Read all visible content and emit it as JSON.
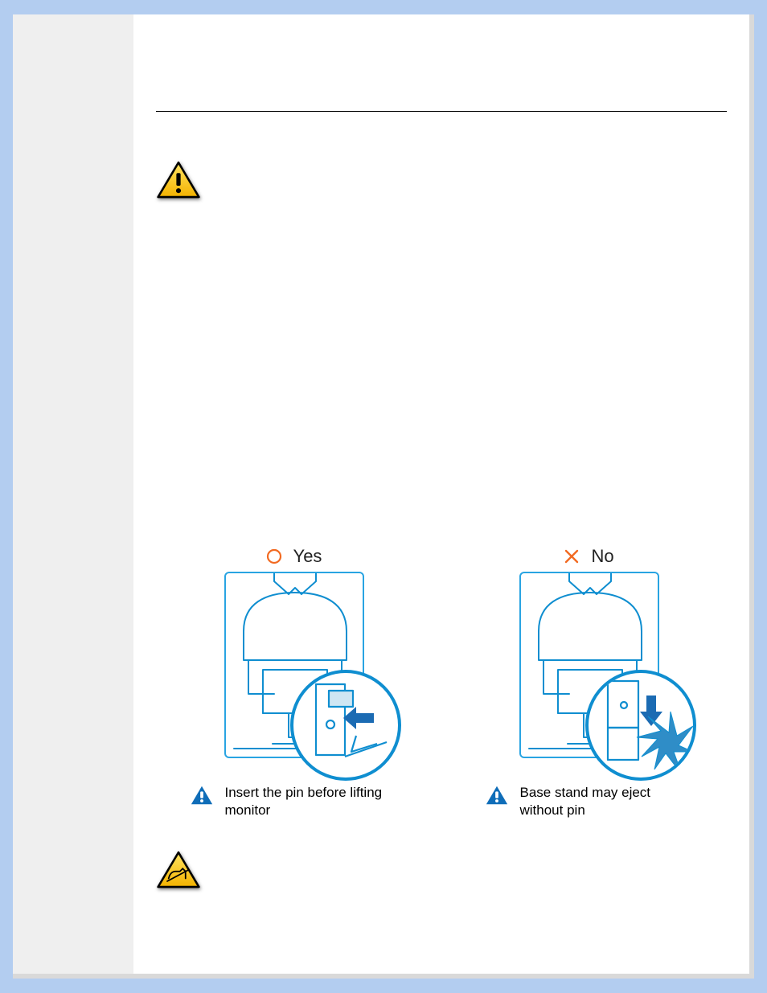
{
  "yes_no": {
    "yes_label": "Yes",
    "no_label": "No",
    "yes_caption": "Insert the pin before lifting monitor",
    "no_caption": "Base stand may eject without pin"
  },
  "icons": {
    "warning": "warning-triangle",
    "caution_touch": "caution-no-touch",
    "alert": "alert-triangle",
    "circle": "circle-outline",
    "cross": "x-mark"
  },
  "colors": {
    "border_blue": "#b3cdf0",
    "diagram_blue": "#0f8ed0",
    "warn_yellow": "#f6c800",
    "warn_border": "#000000",
    "orange": "#f26a21"
  }
}
